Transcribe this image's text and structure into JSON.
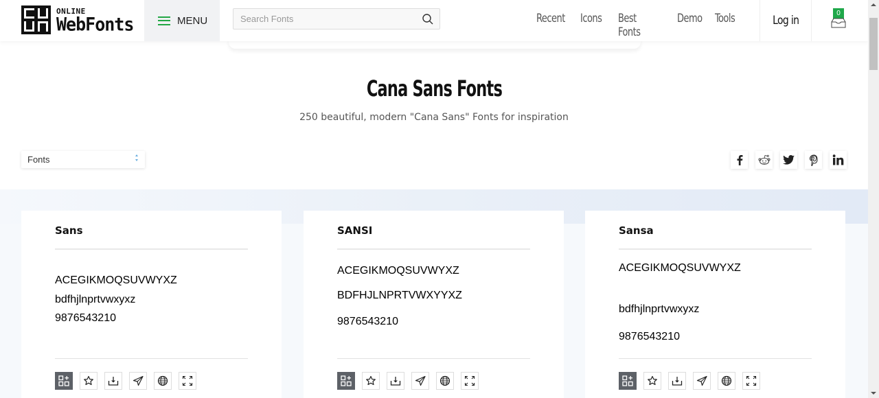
{
  "header": {
    "logo": {
      "small": "ONLINE",
      "big": "WebFonts"
    },
    "menu_label": "MENU",
    "search_placeholder": "Search Fonts",
    "nav": [
      "Recent",
      "Icons",
      "Best Fonts",
      "Demo",
      "Tools"
    ],
    "login_label": "Log in",
    "cart_count": "0"
  },
  "page": {
    "title": "Cana Sans Fonts",
    "subtitle": "250 beautiful, modern \"Cana Sans\" Fonts for inspiration"
  },
  "filter": {
    "selected": "Fonts"
  },
  "share": [
    "facebook",
    "reddit",
    "twitter",
    "pinterest",
    "linkedin"
  ],
  "colors": {
    "accent_green": "#22a744",
    "badge_green": "#1fa84a",
    "action_primary": "#5d6167"
  },
  "cards": [
    {
      "name": "Sans",
      "preview": [
        {
          "text": "ACEGIKMOQSUVWYXZ",
          "color": "#6b6561"
        },
        {
          "text": "bdfhjlnprtvwxyxz",
          "color": "#5b9a7c"
        },
        {
          "text": "9876543210",
          "color": "#6a5a9e"
        }
      ]
    },
    {
      "name": "SANSI",
      "preview": [
        {
          "text": "ACEGIKMOQSUVWYXZ",
          "color": "#b07fc4"
        },
        {
          "text": "BDFHJLNPRTVWXYYXZ",
          "color": "#7e7878"
        },
        {
          "text": "9876543210",
          "color": "#8a84a6"
        }
      ]
    },
    {
      "name": "Sansa",
      "preview": [
        {
          "text": "ACEGIKMOQSUVWYXZ",
          "color": "#6aa84f"
        },
        {
          "text": "bdfhjlnprtvwxyxz",
          "color": "#68a84c"
        },
        {
          "text": "9876543210",
          "color": "#5e9a7a"
        }
      ]
    }
  ],
  "card_actions": [
    "add-to-collection",
    "favorite",
    "download",
    "send",
    "web-font",
    "fullscreen"
  ]
}
